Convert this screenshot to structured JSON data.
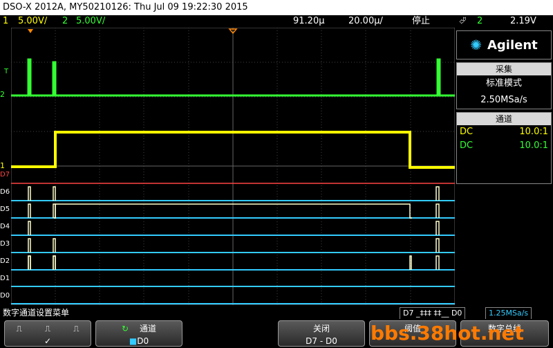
{
  "title": "DSO-X 2012A, MY50210126: Thu Jul 09 19:22:30 2015",
  "status": {
    "ch1_num": "1",
    "ch1_scale": "5.00V/",
    "ch2_num": "2",
    "ch2_scale": "5.00V/",
    "time_offset": "91.20µ",
    "time_scale": "20.00µ/",
    "run_state": "停止",
    "trigger_source": "2",
    "trigger_level": "2.19V"
  },
  "brand": "Agilent",
  "acquisition": {
    "header": "采集",
    "mode": "标准模式",
    "rate": "2.50MSa/s"
  },
  "channels": {
    "header": "通道",
    "rows": [
      {
        "coupling": "DC",
        "probe": "10.0:1",
        "color": "#ffff00"
      },
      {
        "coupling": "DC",
        "probe": "10.0:1",
        "color": "#33ff33"
      }
    ]
  },
  "markers": {
    "trig": "T",
    "ch2": "2",
    "ch1": "1",
    "d7": "D7",
    "d6": "D6",
    "d5": "D5",
    "d4": "D4",
    "d3": "D3",
    "d2": "D2",
    "d1": "D1",
    "d0": "D0"
  },
  "message": "数字通道设置菜单",
  "digital_summary": {
    "text": "D7 _‡‡‡ ‡‡__ D0",
    "rate": "1.25MSa/s"
  },
  "softkeys": {
    "threshold_icons": [
      "⎍",
      "⎍",
      "⎍"
    ],
    "channel_label": "通道",
    "channel_value": "D0",
    "off_label": "关闭",
    "off_value": "D7 - D0",
    "thresh_label": "阈值",
    "bus_label": "数字总线"
  },
  "watermark": "bbs.38hot.net",
  "colors": {
    "ch1": "#ffff00",
    "ch2": "#33ff33",
    "digital": "#33ccff",
    "d7": "#ff4444"
  }
}
